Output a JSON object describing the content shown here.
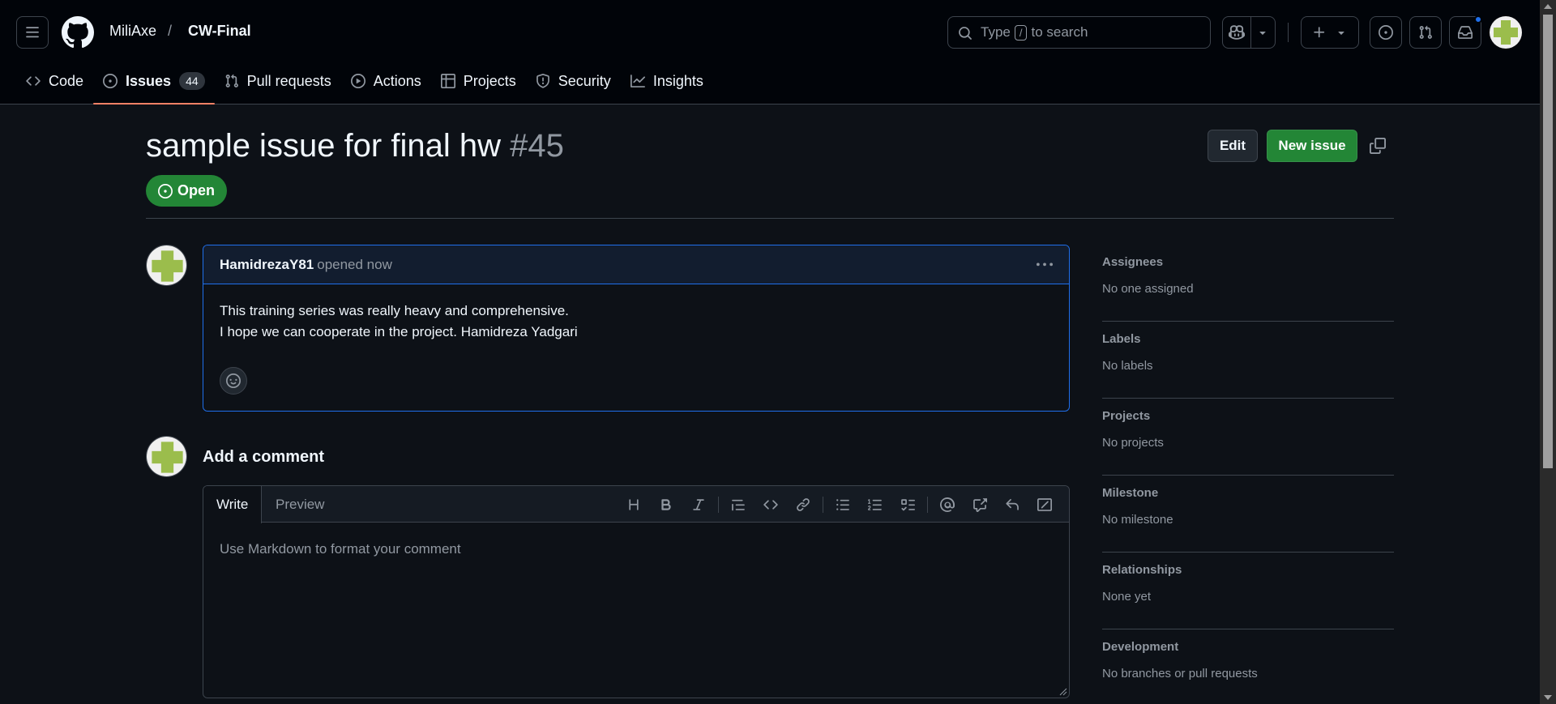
{
  "colors": {
    "accent": "#238636",
    "bg": "#0d1117",
    "header_bg": "#010409",
    "link_blue": "#1f6feb",
    "tab_underline": "#f78166",
    "avatar_green": "#9bbd4c"
  },
  "breadcrumb": {
    "owner": "MiliAxe",
    "separator": "/",
    "repo": "CW-Final"
  },
  "search": {
    "prefix": "Type",
    "key": "/",
    "suffix": "to search"
  },
  "nav": {
    "tabs": [
      {
        "label": "Code",
        "icon": "code-icon"
      },
      {
        "label": "Issues",
        "icon": "issue-opened-icon",
        "count": "44",
        "active": true
      },
      {
        "label": "Pull requests",
        "icon": "git-pull-request-icon"
      },
      {
        "label": "Actions",
        "icon": "play-icon"
      },
      {
        "label": "Projects",
        "icon": "table-icon"
      },
      {
        "label": "Security",
        "icon": "shield-icon"
      },
      {
        "label": "Insights",
        "icon": "graph-icon"
      }
    ]
  },
  "issue": {
    "title": "sample issue for final hw",
    "number": "#45",
    "state": "Open",
    "edit_label": "Edit",
    "new_issue_label": "New issue"
  },
  "comment": {
    "author": "HamidrezaY81",
    "meta": "opened now",
    "body_line1": "This training series was really heavy and comprehensive.",
    "body_line2": "I hope we can cooperate in the project. Hamidreza Yadgari"
  },
  "new_comment": {
    "heading": "Add a comment",
    "tab_write": "Write",
    "tab_preview": "Preview",
    "placeholder": "Use Markdown to format your comment",
    "tools": [
      "heading-icon",
      "bold-icon",
      "italic-icon",
      "quote-icon",
      "code-icon",
      "link-icon",
      "unordered-list-icon",
      "ordered-list-icon",
      "tasklist-icon",
      "mention-icon",
      "cross-reference-icon",
      "reply-icon",
      "slash-command-icon"
    ]
  },
  "sidebar": {
    "sections": [
      {
        "title": "Assignees",
        "value": "No one assigned"
      },
      {
        "title": "Labels",
        "value": "No labels"
      },
      {
        "title": "Projects",
        "value": "No projects"
      },
      {
        "title": "Milestone",
        "value": "No milestone"
      },
      {
        "title": "Relationships",
        "value": "None yet"
      },
      {
        "title": "Development",
        "value": "No branches or pull requests"
      }
    ]
  }
}
